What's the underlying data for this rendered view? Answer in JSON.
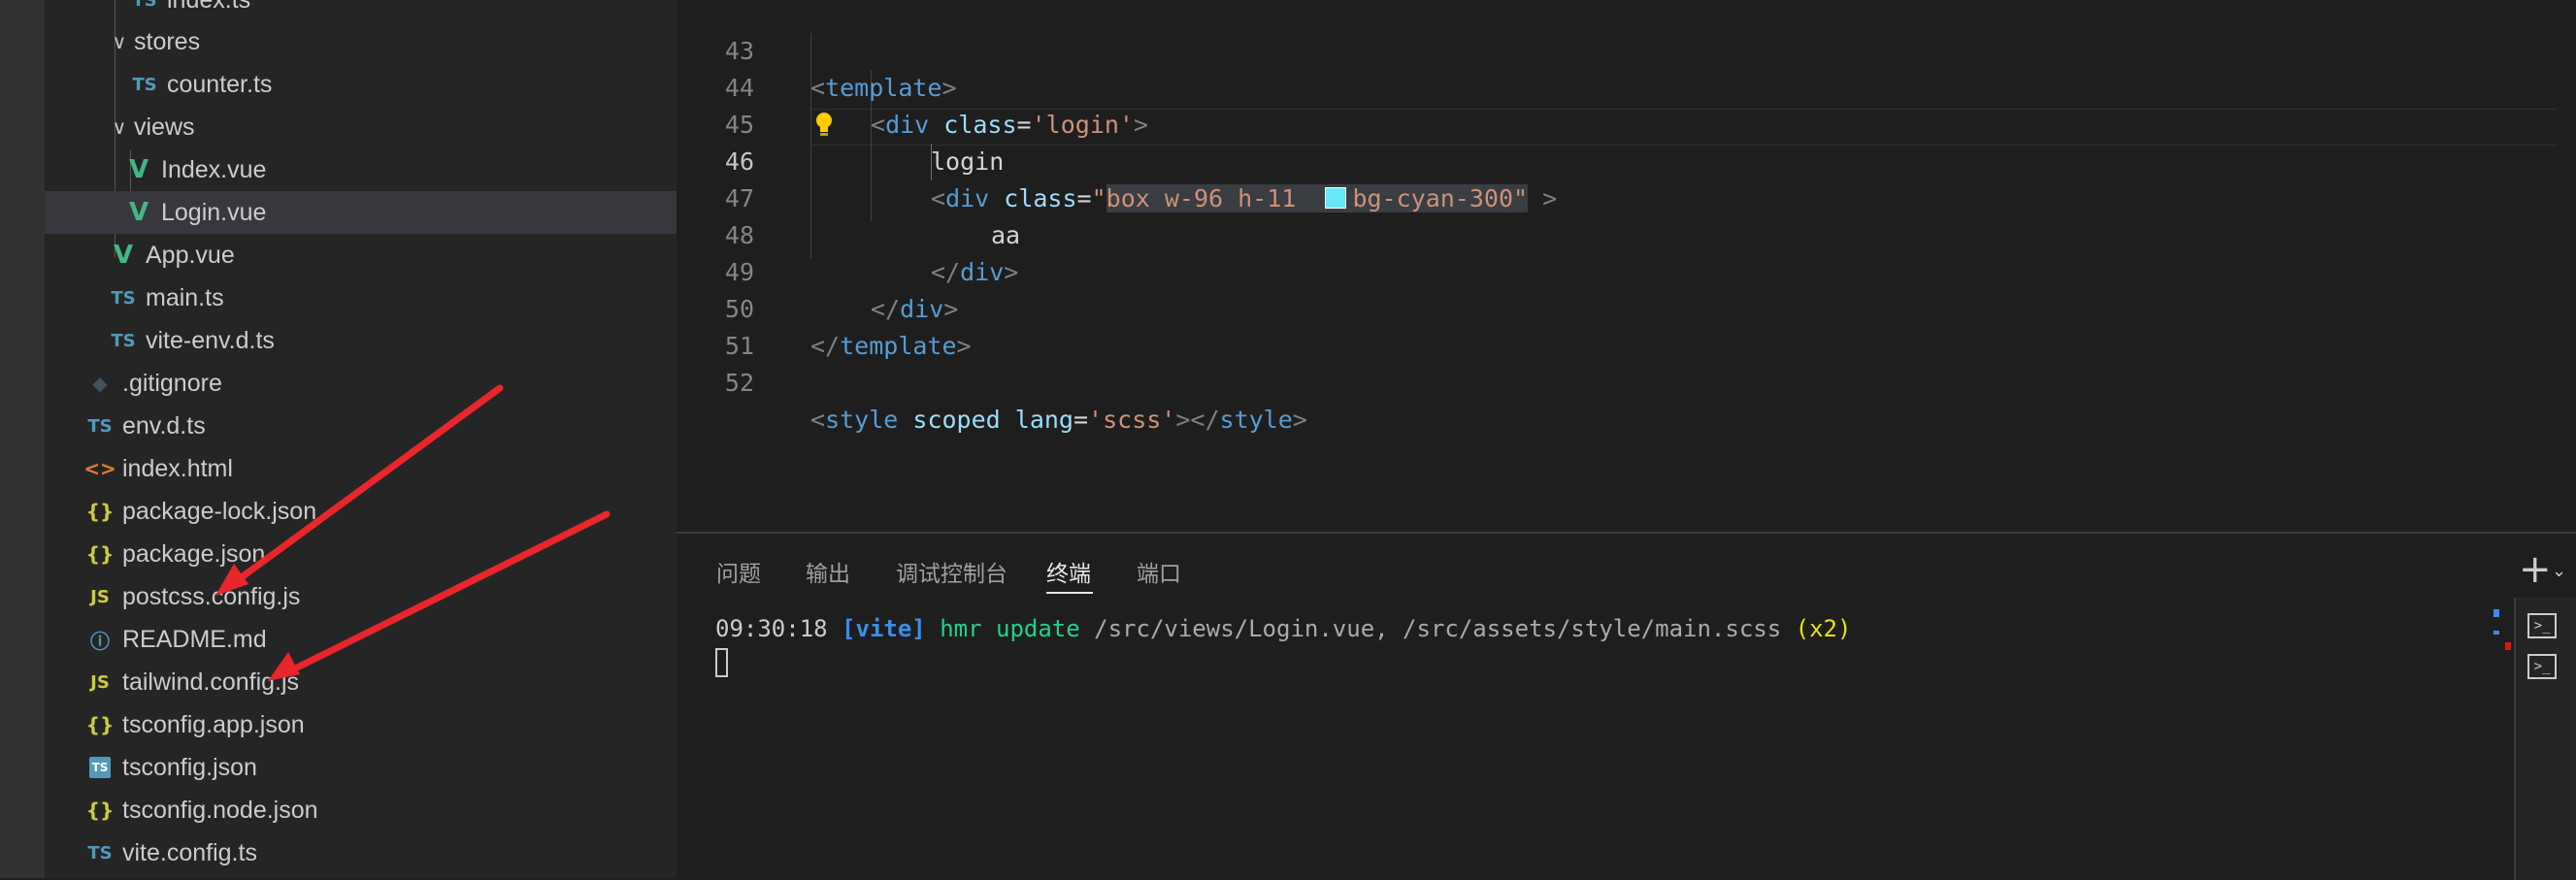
{
  "explorer": {
    "items": [
      {
        "name": "index.ts",
        "icon": "typescript-file-icon"
      },
      {
        "name": "stores",
        "icon": "chevron-down-icon"
      },
      {
        "name": "counter.ts",
        "icon": "typescript-file-icon"
      },
      {
        "name": "views",
        "icon": "chevron-down-icon"
      },
      {
        "name": "Index.vue",
        "icon": "vue-file-icon"
      },
      {
        "name": "Login.vue",
        "icon": "vue-file-icon"
      },
      {
        "name": "App.vue",
        "icon": "vue-file-icon"
      },
      {
        "name": "main.ts",
        "icon": "typescript-file-icon"
      },
      {
        "name": "vite-env.d.ts",
        "icon": "typescript-file-icon"
      },
      {
        "name": ".gitignore",
        "icon": "git-file-icon"
      },
      {
        "name": "env.d.ts",
        "icon": "typescript-file-icon"
      },
      {
        "name": "index.html",
        "icon": "html-file-icon"
      },
      {
        "name": "package-lock.json",
        "icon": "json-file-icon"
      },
      {
        "name": "package.json",
        "icon": "json-file-icon"
      },
      {
        "name": "postcss.config.js",
        "icon": "javascript-file-icon"
      },
      {
        "name": "README.md",
        "icon": "info-file-icon"
      },
      {
        "name": "tailwind.config.js",
        "icon": "javascript-file-icon"
      },
      {
        "name": "tsconfig.app.json",
        "icon": "json-file-icon"
      },
      {
        "name": "tsconfig.json",
        "icon": "tsconfig-file-icon"
      },
      {
        "name": "tsconfig.node.json",
        "icon": "json-file-icon"
      },
      {
        "name": "vite.config.ts",
        "icon": "typescript-file-icon"
      }
    ],
    "icon_glyphs": {
      "ts": "TS",
      "vue": "V",
      "js": "JS",
      "json": "{}",
      "html": "<>",
      "git": "◆",
      "info": "ⓘ",
      "chevron": "∨",
      "tsconfig": "TS"
    }
  },
  "editor": {
    "line_numbers": [
      "43",
      "44",
      "45",
      "46",
      "47",
      "48",
      "49",
      "50",
      "51",
      "52"
    ],
    "active_line": "46",
    "code": {
      "l43": {
        "lt": "<",
        "tag": "template",
        "gt": ">"
      },
      "l44": {
        "lt": "<",
        "tag": "div",
        "attr": "class",
        "eq": "=",
        "val": "'login'",
        "gt": ">"
      },
      "l45": {
        "text": "login"
      },
      "l46": {
        "lt": "<",
        "tag": "div",
        "attr": "class",
        "eq": "=",
        "q": "\"",
        "val1": "box w-96 h-11  ",
        "val2": "bg-cyan-300",
        "q2": "\"",
        "gt": " >"
      },
      "l47": {
        "text": "aa"
      },
      "l48": {
        "lt": "</",
        "tag": "div",
        "gt": ">"
      },
      "l49": {
        "lt": "</",
        "tag": "div",
        "gt": ">"
      },
      "l50": {
        "lt": "</",
        "tag": "template",
        "gt": ">"
      },
      "l52": {
        "lt": "<",
        "tag": "style",
        "attr1": "scoped",
        "attr2": "lang",
        "eq": "=",
        "val": "'scss'",
        "gt": ">",
        "lt2": "</",
        "tag2": "style",
        "gt2": ">"
      }
    },
    "swatch_color": "#67e8f9"
  },
  "panel": {
    "tabs": [
      "问题",
      "输出",
      "调试控制台",
      "终端",
      "端口"
    ],
    "active_tab": "终端",
    "terminal": {
      "time": "09:30:18",
      "tag": "[vite]",
      "msg": "hmr update",
      "paths": "/src/views/Login.vue, /src/assets/style/main.scss",
      "count": "(x2)"
    },
    "actions": {
      "new_terminal": "+",
      "dropdown": "⌄",
      "terminal_glyph": ">_"
    }
  },
  "colors": {
    "arrow": "#e8262b",
    "accent_green": "#23d18b",
    "accent_blue": "#3b8eea",
    "accent_yellow": "#e5e510"
  }
}
